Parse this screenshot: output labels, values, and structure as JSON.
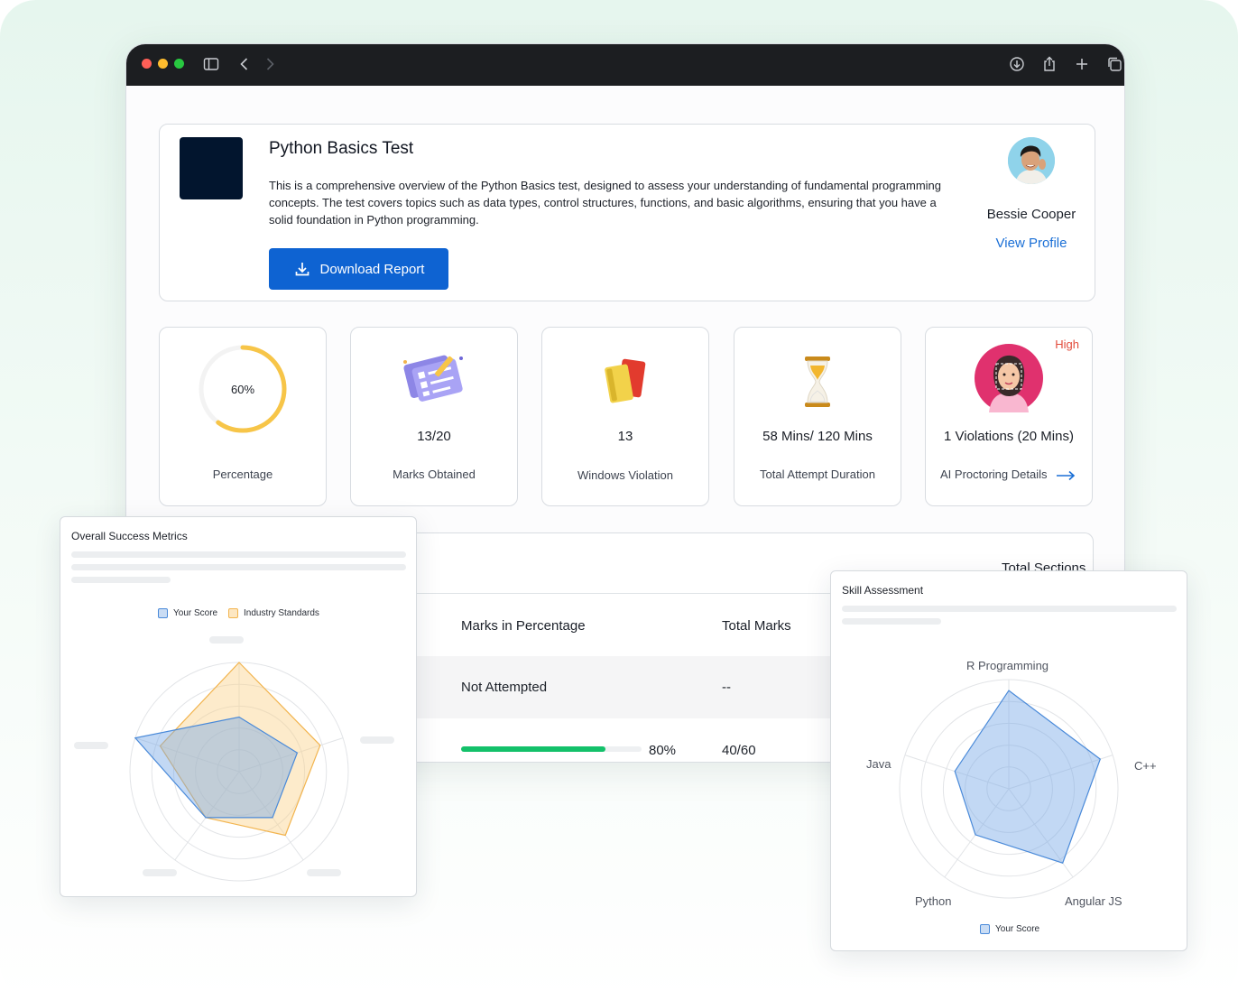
{
  "window": {
    "traffic_lights": [
      "#ff5f57",
      "#febc2e",
      "#28c840"
    ],
    "titlebar_color": "#1c1e21"
  },
  "test": {
    "title": "Python Basics Test",
    "description": "This is a comprehensive overview of the Python Basics test, designed to assess your understanding of fundamental programming concepts. The test covers topics such as data types, control structures, functions, and basic algorithms, ensuring that you have a solid foundation in Python programming.",
    "download_label": "Download Report"
  },
  "user": {
    "name": "Bessie Cooper",
    "view_profile": "View Profile"
  },
  "stats": {
    "percentage": {
      "value": "60%",
      "fraction": 0.6,
      "label": "Percentage"
    },
    "marks": {
      "value": "13/20",
      "label": "Marks Obtained"
    },
    "windows": {
      "value": "13",
      "label": "Windows Violation"
    },
    "duration": {
      "value": "58 Mins/ 120 Mins",
      "label": "Total Attempt Duration"
    },
    "proctoring": {
      "value": "1 Violations (20 Mins)",
      "label": "AI Proctoring Details",
      "badge": "High"
    }
  },
  "sections": {
    "total_label": "Total Sections : 5",
    "columns": [
      "Marks in Percentage",
      "Total Marks"
    ],
    "rows": [
      {
        "marks_pct": "Not Attempted",
        "total": "--"
      },
      {
        "marks_pct": "80%",
        "progress": 0.8,
        "total": "40/60"
      }
    ]
  },
  "success_panel": {
    "title": "Overall Success Metrics"
  },
  "skill_panel": {
    "title": "Skill Assessment"
  },
  "chart_data": [
    {
      "type": "radar",
      "title": "Overall Success Metrics",
      "axes": [
        "",
        "",
        "",
        "",
        ""
      ],
      "range": [
        0,
        5
      ],
      "rings": 5,
      "series": [
        {
          "name": "Your Score",
          "values": [
            2.5,
            2.8,
            2.6,
            2.6,
            5.0
          ],
          "color": "#4a8ad9"
        },
        {
          "name": "Industry Standards",
          "values": [
            5.0,
            3.9,
            3.6,
            2.6,
            3.8
          ],
          "color": "#f2b44e"
        }
      ]
    },
    {
      "type": "radar",
      "title": "Skill Assessment",
      "axes": [
        "R Programming",
        "C++",
        "Angular JS",
        "Python",
        "Java"
      ],
      "range": [
        0,
        5
      ],
      "rings": 5,
      "series": [
        {
          "name": "Your Score",
          "values": [
            4.5,
            4.4,
            4.2,
            2.6,
            2.6
          ],
          "color": "#4a8ad9"
        }
      ]
    }
  ]
}
